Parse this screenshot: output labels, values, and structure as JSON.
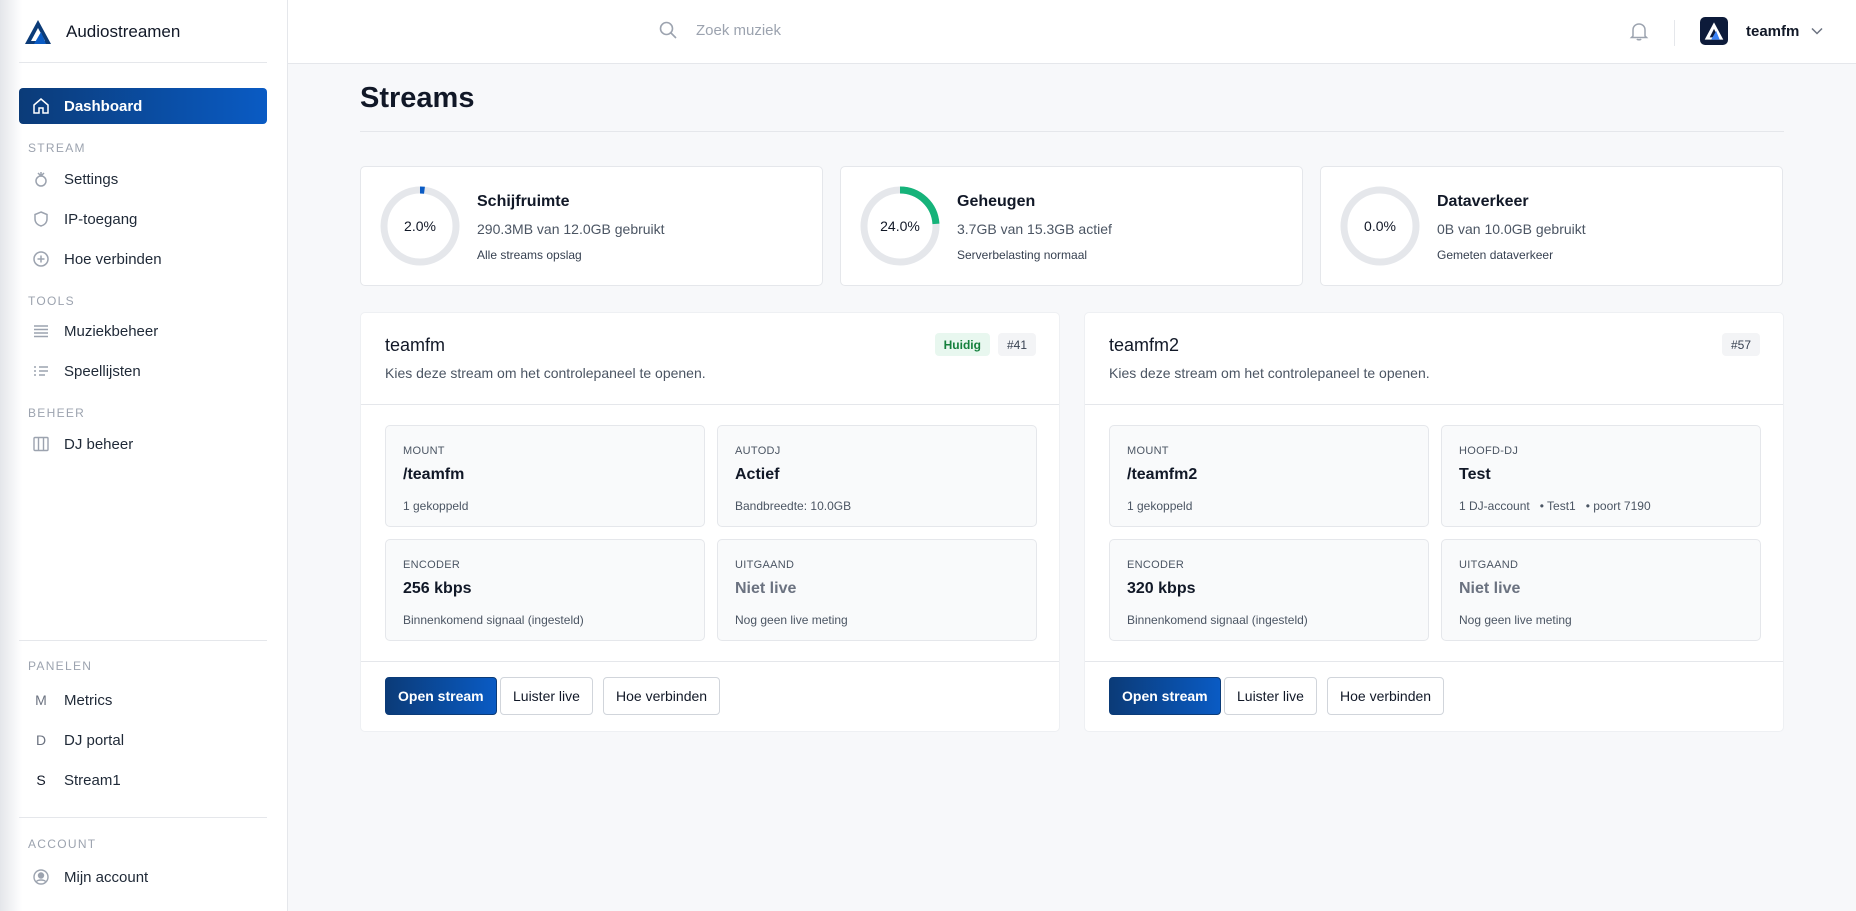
{
  "app": {
    "name": "Audiostreamen"
  },
  "sidebar": {
    "dashboard": "Dashboard",
    "sections": {
      "stream": "STREAM",
      "tools": "TOOLS",
      "beheer": "BEHEER",
      "panelen": "PANELEN",
      "account": "ACCOUNT"
    },
    "stream_items": [
      "Settings",
      "IP-toegang",
      "Hoe verbinden"
    ],
    "tools_items": [
      "Muziekbeheer",
      "Speellijsten"
    ],
    "beheer_items": [
      "DJ beheer"
    ],
    "panels": [
      {
        "letter": "M",
        "label": "Metrics"
      },
      {
        "letter": "D",
        "label": "DJ portal"
      },
      {
        "letter": "S",
        "label": "Stream1"
      }
    ],
    "account_items": [
      "Mijn account"
    ]
  },
  "topbar": {
    "search_placeholder": "Zoek muziek",
    "user": "teamfm"
  },
  "page": {
    "title": "Streams"
  },
  "stats": [
    {
      "pct": 2.0,
      "pct_label": "2.0%",
      "title": "Schijfruimte",
      "sub": "290.3MB van 12.0GB gebruikt",
      "note": "Alle streams opslag",
      "color": "#0a5bc4"
    },
    {
      "pct": 24.0,
      "pct_label": "24.0%",
      "title": "Geheugen",
      "sub": "3.7GB van 15.3GB actief",
      "note": "Serverbelasting normaal",
      "color": "#16b37a"
    },
    {
      "pct": 0.0,
      "pct_label": "0.0%",
      "title": "Dataverkeer",
      "sub": "0B van 10.0GB gebruikt",
      "note": "Gemeten dataverkeer",
      "color": "#0a5bc4"
    }
  ],
  "streams": [
    {
      "name": "teamfm",
      "desc": "Kies deze stream om het controlepaneel te openen.",
      "badge_current": "Huidig",
      "id": "#41",
      "tiles": [
        {
          "label": "MOUNT",
          "value": "/teamfm",
          "note": "1 gekoppeld"
        },
        {
          "label": "AUTODJ",
          "value": "Actief",
          "note": "Bandbreedte: 10.0GB"
        },
        {
          "label": "ENCODER",
          "value": "256 kbps",
          "note": "Binnenkomend signaal (ingesteld)"
        },
        {
          "label": "UITGAAND",
          "value": "Niet live",
          "note": "Nog geen live meting"
        }
      ],
      "buttons": {
        "open": "Open stream",
        "listen": "Luister live",
        "connect": "Hoe verbinden"
      }
    },
    {
      "name": "teamfm2",
      "desc": "Kies deze stream om het controlepaneel te openen.",
      "id": "#57",
      "tiles": [
        {
          "label": "MOUNT",
          "value": "/teamfm2",
          "note": "1 gekoppeld"
        },
        {
          "label": "HOOFD-DJ",
          "value": "Test",
          "note": "1 DJ-account   • Test1   • poort 7190"
        },
        {
          "label": "ENCODER",
          "value": "320 kbps",
          "note": "Binnenkomend signaal (ingesteld)"
        },
        {
          "label": "UITGAAND",
          "value": "Niet live",
          "note": "Nog geen live meting"
        }
      ],
      "buttons": {
        "open": "Open stream",
        "listen": "Luister live",
        "connect": "Hoe verbinden"
      }
    }
  ]
}
